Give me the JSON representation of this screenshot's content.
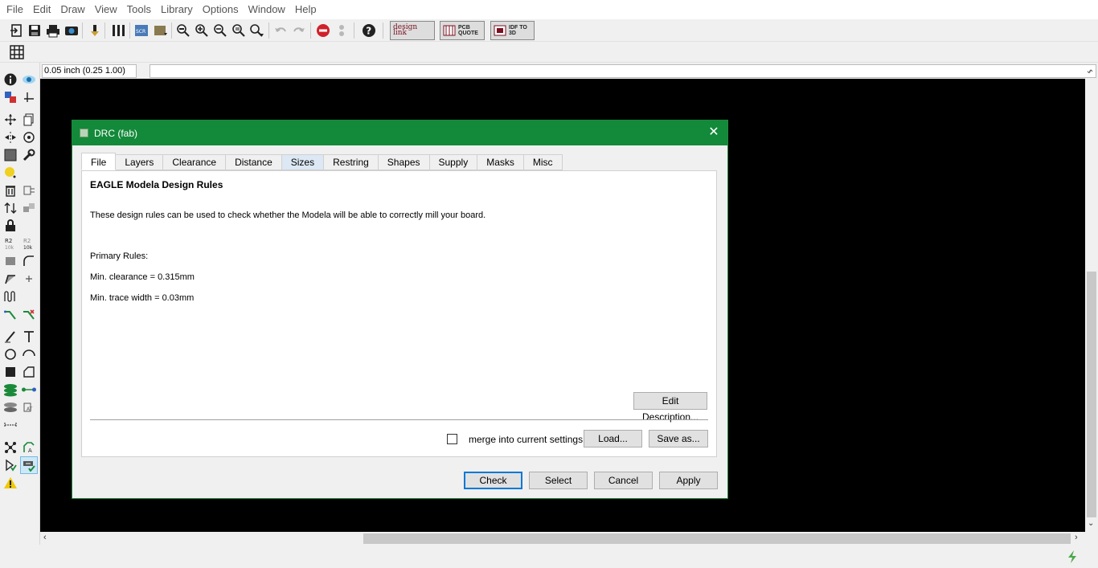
{
  "menu": [
    "File",
    "Edit",
    "Draw",
    "View",
    "Tools",
    "Library",
    "Options",
    "Window",
    "Help"
  ],
  "toolbar": {
    "brand_designlink": "design link",
    "brand_pcb": "PCB QUOTE",
    "brand_idf": "IDF TO 3D"
  },
  "command": {
    "grid_display": "0.05 inch (0.25 1.00)",
    "input_value": ""
  },
  "dialog": {
    "title": "DRC (fab)",
    "tabs": [
      "File",
      "Layers",
      "Clearance",
      "Distance",
      "Sizes",
      "Restring",
      "Shapes",
      "Supply",
      "Masks",
      "Misc"
    ],
    "active_tab": "File",
    "heading": "EAGLE Modela Design Rules",
    "description": "These design rules can be used to check whether the Modela will be able to correctly mill your board.",
    "rules_header": "Primary Rules:",
    "rule_clearance": "Min. clearance = 0.315mm",
    "rule_trace": "Min. trace width = 0.03mm",
    "edit_description_label": "Edit Description...",
    "merge_label": "merge into current settings",
    "merge_checked": false,
    "load_label": "Load...",
    "save_as_label": "Save as...",
    "check_label": "Check",
    "select_label": "Select",
    "cancel_label": "Cancel",
    "apply_label": "Apply"
  },
  "colors": {
    "title_bar": "#13893a",
    "canvas": "#000000",
    "focus_border": "#0078d7"
  }
}
